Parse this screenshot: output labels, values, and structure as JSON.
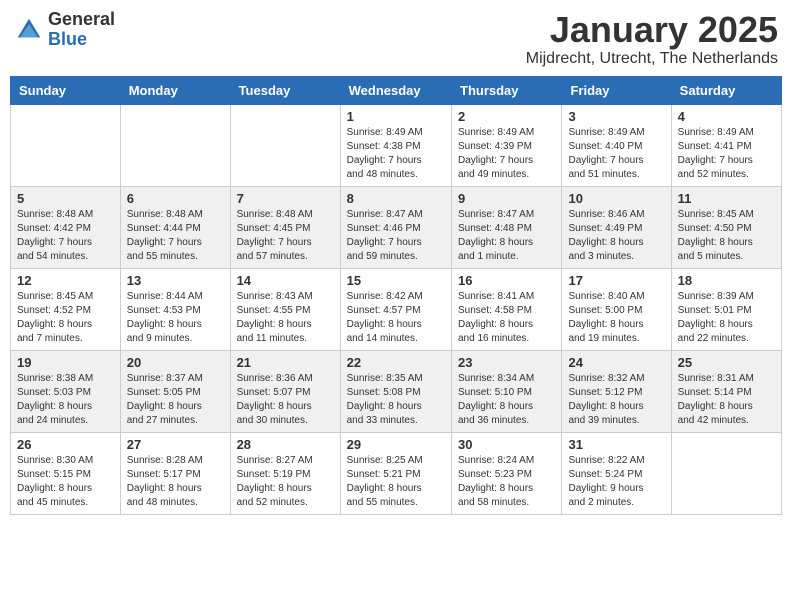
{
  "logo": {
    "general": "General",
    "blue": "Blue"
  },
  "title": "January 2025",
  "location": "Mijdrecht, Utrecht, The Netherlands",
  "days_of_week": [
    "Sunday",
    "Monday",
    "Tuesday",
    "Wednesday",
    "Thursday",
    "Friday",
    "Saturday"
  ],
  "weeks": [
    [
      {
        "day": "",
        "info": ""
      },
      {
        "day": "",
        "info": ""
      },
      {
        "day": "",
        "info": ""
      },
      {
        "day": "1",
        "info": "Sunrise: 8:49 AM\nSunset: 4:38 PM\nDaylight: 7 hours\nand 48 minutes."
      },
      {
        "day": "2",
        "info": "Sunrise: 8:49 AM\nSunset: 4:39 PM\nDaylight: 7 hours\nand 49 minutes."
      },
      {
        "day": "3",
        "info": "Sunrise: 8:49 AM\nSunset: 4:40 PM\nDaylight: 7 hours\nand 51 minutes."
      },
      {
        "day": "4",
        "info": "Sunrise: 8:49 AM\nSunset: 4:41 PM\nDaylight: 7 hours\nand 52 minutes."
      }
    ],
    [
      {
        "day": "5",
        "info": "Sunrise: 8:48 AM\nSunset: 4:42 PM\nDaylight: 7 hours\nand 54 minutes."
      },
      {
        "day": "6",
        "info": "Sunrise: 8:48 AM\nSunset: 4:44 PM\nDaylight: 7 hours\nand 55 minutes."
      },
      {
        "day": "7",
        "info": "Sunrise: 8:48 AM\nSunset: 4:45 PM\nDaylight: 7 hours\nand 57 minutes."
      },
      {
        "day": "8",
        "info": "Sunrise: 8:47 AM\nSunset: 4:46 PM\nDaylight: 7 hours\nand 59 minutes."
      },
      {
        "day": "9",
        "info": "Sunrise: 8:47 AM\nSunset: 4:48 PM\nDaylight: 8 hours\nand 1 minute."
      },
      {
        "day": "10",
        "info": "Sunrise: 8:46 AM\nSunset: 4:49 PM\nDaylight: 8 hours\nand 3 minutes."
      },
      {
        "day": "11",
        "info": "Sunrise: 8:45 AM\nSunset: 4:50 PM\nDaylight: 8 hours\nand 5 minutes."
      }
    ],
    [
      {
        "day": "12",
        "info": "Sunrise: 8:45 AM\nSunset: 4:52 PM\nDaylight: 8 hours\nand 7 minutes."
      },
      {
        "day": "13",
        "info": "Sunrise: 8:44 AM\nSunset: 4:53 PM\nDaylight: 8 hours\nand 9 minutes."
      },
      {
        "day": "14",
        "info": "Sunrise: 8:43 AM\nSunset: 4:55 PM\nDaylight: 8 hours\nand 11 minutes."
      },
      {
        "day": "15",
        "info": "Sunrise: 8:42 AM\nSunset: 4:57 PM\nDaylight: 8 hours\nand 14 minutes."
      },
      {
        "day": "16",
        "info": "Sunrise: 8:41 AM\nSunset: 4:58 PM\nDaylight: 8 hours\nand 16 minutes."
      },
      {
        "day": "17",
        "info": "Sunrise: 8:40 AM\nSunset: 5:00 PM\nDaylight: 8 hours\nand 19 minutes."
      },
      {
        "day": "18",
        "info": "Sunrise: 8:39 AM\nSunset: 5:01 PM\nDaylight: 8 hours\nand 22 minutes."
      }
    ],
    [
      {
        "day": "19",
        "info": "Sunrise: 8:38 AM\nSunset: 5:03 PM\nDaylight: 8 hours\nand 24 minutes."
      },
      {
        "day": "20",
        "info": "Sunrise: 8:37 AM\nSunset: 5:05 PM\nDaylight: 8 hours\nand 27 minutes."
      },
      {
        "day": "21",
        "info": "Sunrise: 8:36 AM\nSunset: 5:07 PM\nDaylight: 8 hours\nand 30 minutes."
      },
      {
        "day": "22",
        "info": "Sunrise: 8:35 AM\nSunset: 5:08 PM\nDaylight: 8 hours\nand 33 minutes."
      },
      {
        "day": "23",
        "info": "Sunrise: 8:34 AM\nSunset: 5:10 PM\nDaylight: 8 hours\nand 36 minutes."
      },
      {
        "day": "24",
        "info": "Sunrise: 8:32 AM\nSunset: 5:12 PM\nDaylight: 8 hours\nand 39 minutes."
      },
      {
        "day": "25",
        "info": "Sunrise: 8:31 AM\nSunset: 5:14 PM\nDaylight: 8 hours\nand 42 minutes."
      }
    ],
    [
      {
        "day": "26",
        "info": "Sunrise: 8:30 AM\nSunset: 5:15 PM\nDaylight: 8 hours\nand 45 minutes."
      },
      {
        "day": "27",
        "info": "Sunrise: 8:28 AM\nSunset: 5:17 PM\nDaylight: 8 hours\nand 48 minutes."
      },
      {
        "day": "28",
        "info": "Sunrise: 8:27 AM\nSunset: 5:19 PM\nDaylight: 8 hours\nand 52 minutes."
      },
      {
        "day": "29",
        "info": "Sunrise: 8:25 AM\nSunset: 5:21 PM\nDaylight: 8 hours\nand 55 minutes."
      },
      {
        "day": "30",
        "info": "Sunrise: 8:24 AM\nSunset: 5:23 PM\nDaylight: 8 hours\nand 58 minutes."
      },
      {
        "day": "31",
        "info": "Sunrise: 8:22 AM\nSunset: 5:24 PM\nDaylight: 9 hours\nand 2 minutes."
      },
      {
        "day": "",
        "info": ""
      }
    ]
  ]
}
